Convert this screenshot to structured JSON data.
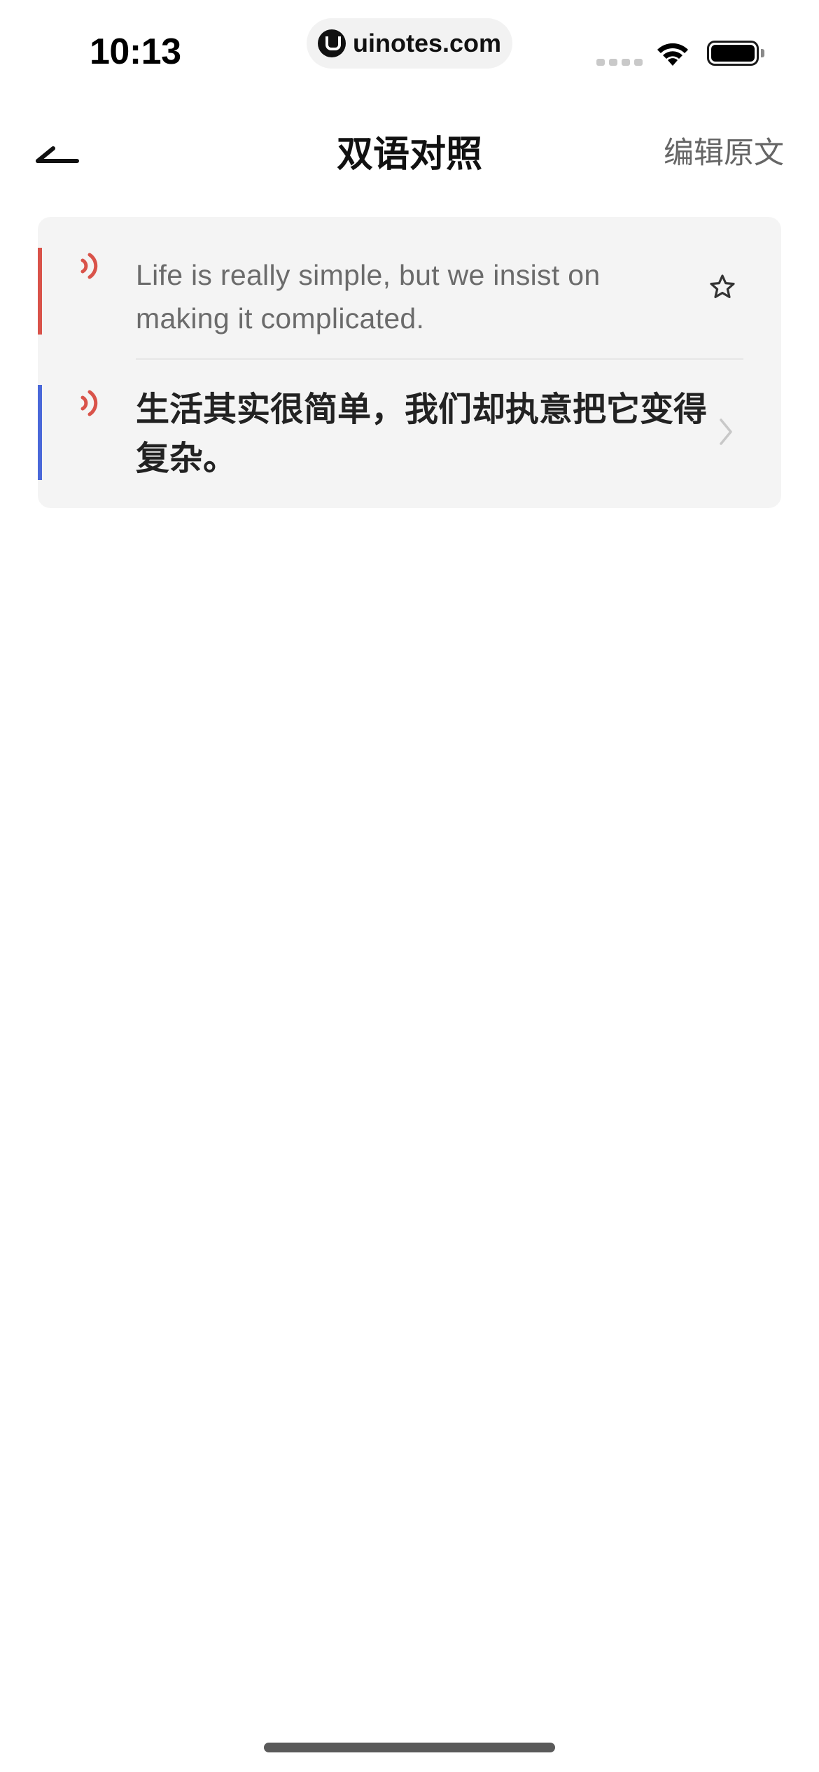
{
  "status_bar": {
    "time": "10:13",
    "url": "uinotes.com",
    "icons": {
      "site_logo": "uinotes-logo-icon",
      "signal": "cellular-signal-icon",
      "wifi": "wifi-icon",
      "battery": "battery-icon"
    }
  },
  "nav": {
    "back_icon": "back-arrow-icon",
    "title": "双语对照",
    "edit_label": "编辑原文"
  },
  "card": {
    "original": {
      "speaker_icon": "speaker-icon",
      "text": "Life is really simple, but we insist on making it complicated.",
      "accent_color": "#d9534a",
      "favorite_icon": "star-outline-icon"
    },
    "translation": {
      "speaker_icon": "speaker-icon",
      "text": "生活其实很简单，我们却执意把它变得复杂。",
      "accent_color": "#4a68d9",
      "chevron_icon": "chevron-right-icon"
    }
  },
  "colors": {
    "speaker_red": "#d9534a",
    "card_background": "#f4f4f4",
    "secondary_text": "#6b6b6b"
  }
}
